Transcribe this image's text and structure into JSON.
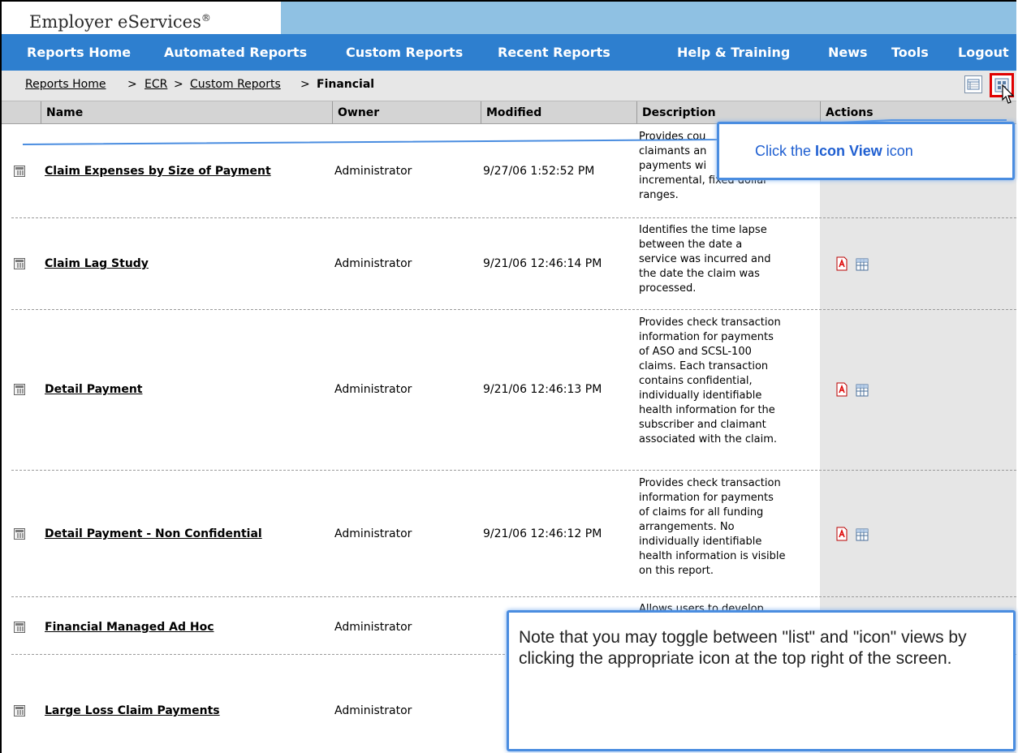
{
  "brand": {
    "title": "Employer eServices",
    "mark": "®"
  },
  "nav": [
    "Reports Home",
    "Automated Reports",
    "Custom Reports",
    "Recent Reports",
    "Help & Training",
    "News",
    "Tools",
    "Logout"
  ],
  "breadcrumb": {
    "items": [
      "Reports Home",
      "ECR",
      "Custom Reports"
    ],
    "separator": ">",
    "current": "Financial"
  },
  "table": {
    "columns": [
      "Name",
      "Owner",
      "Modified",
      "Description",
      "Actions"
    ],
    "rows": [
      {
        "name": "Claim Expenses by Size of Payment",
        "owner": "Administrator",
        "modified": "9/27/06 1:52:52 PM",
        "description": [
          "Provides cou",
          "claimants an",
          "payments wi",
          "incremental, fixed dollar",
          "ranges."
        ]
      },
      {
        "name": "Claim Lag Study",
        "owner": "Administrator",
        "modified": "9/21/06 12:46:14 PM",
        "description": [
          "Identifies the time lapse",
          "between the date a",
          "service was incurred and",
          "the date the claim was",
          "processed."
        ]
      },
      {
        "name": "Detail Payment",
        "owner": "Administrator",
        "modified": "9/21/06 12:46:13 PM",
        "description": [
          "Provides check transaction",
          "information for payments",
          "of ASO and SCSL-100",
          "claims.  Each transaction",
          "contains confidential,",
          "individually identifiable",
          "health information for the",
          "subscriber and claimant",
          "associated with the claim."
        ]
      },
      {
        "name": "Detail Payment - Non Confidential",
        "owner": "Administrator",
        "modified": "9/21/06 12:46:12 PM",
        "description": [
          "Provides check transaction",
          "information for payments",
          "of claims for all funding",
          "arrangements.  No",
          "individually identifiable",
          "health information is visible",
          "on this report."
        ]
      },
      {
        "name": "Financial Managed Ad Hoc",
        "owner": "Administrator",
        "modified": "",
        "description": [
          "Allows users to develop"
        ]
      },
      {
        "name": "Large Loss Claim Payments",
        "owner": "Administrator",
        "modified": "",
        "description": []
      }
    ]
  },
  "callouts": {
    "icon_view": {
      "prefix": "Click the ",
      "bold": "Icon View",
      "suffix": " icon"
    },
    "note": "Note that you may toggle between \"list\" and \"icon\" views by clicking the appropriate icon at the top right of the screen."
  },
  "colors": {
    "brand_bar": "#8fc1e3",
    "nav_bar": "#2e7fcf",
    "callout_border": "#4a8de0",
    "highlight": "#e00000"
  },
  "icons": {
    "list_view": "list-view-icon",
    "icon_view": "icon-view-icon",
    "pdf": "pdf-icon",
    "excel": "spreadsheet-icon",
    "report": "report-icon",
    "cursor": "mouse-pointer-icon"
  }
}
